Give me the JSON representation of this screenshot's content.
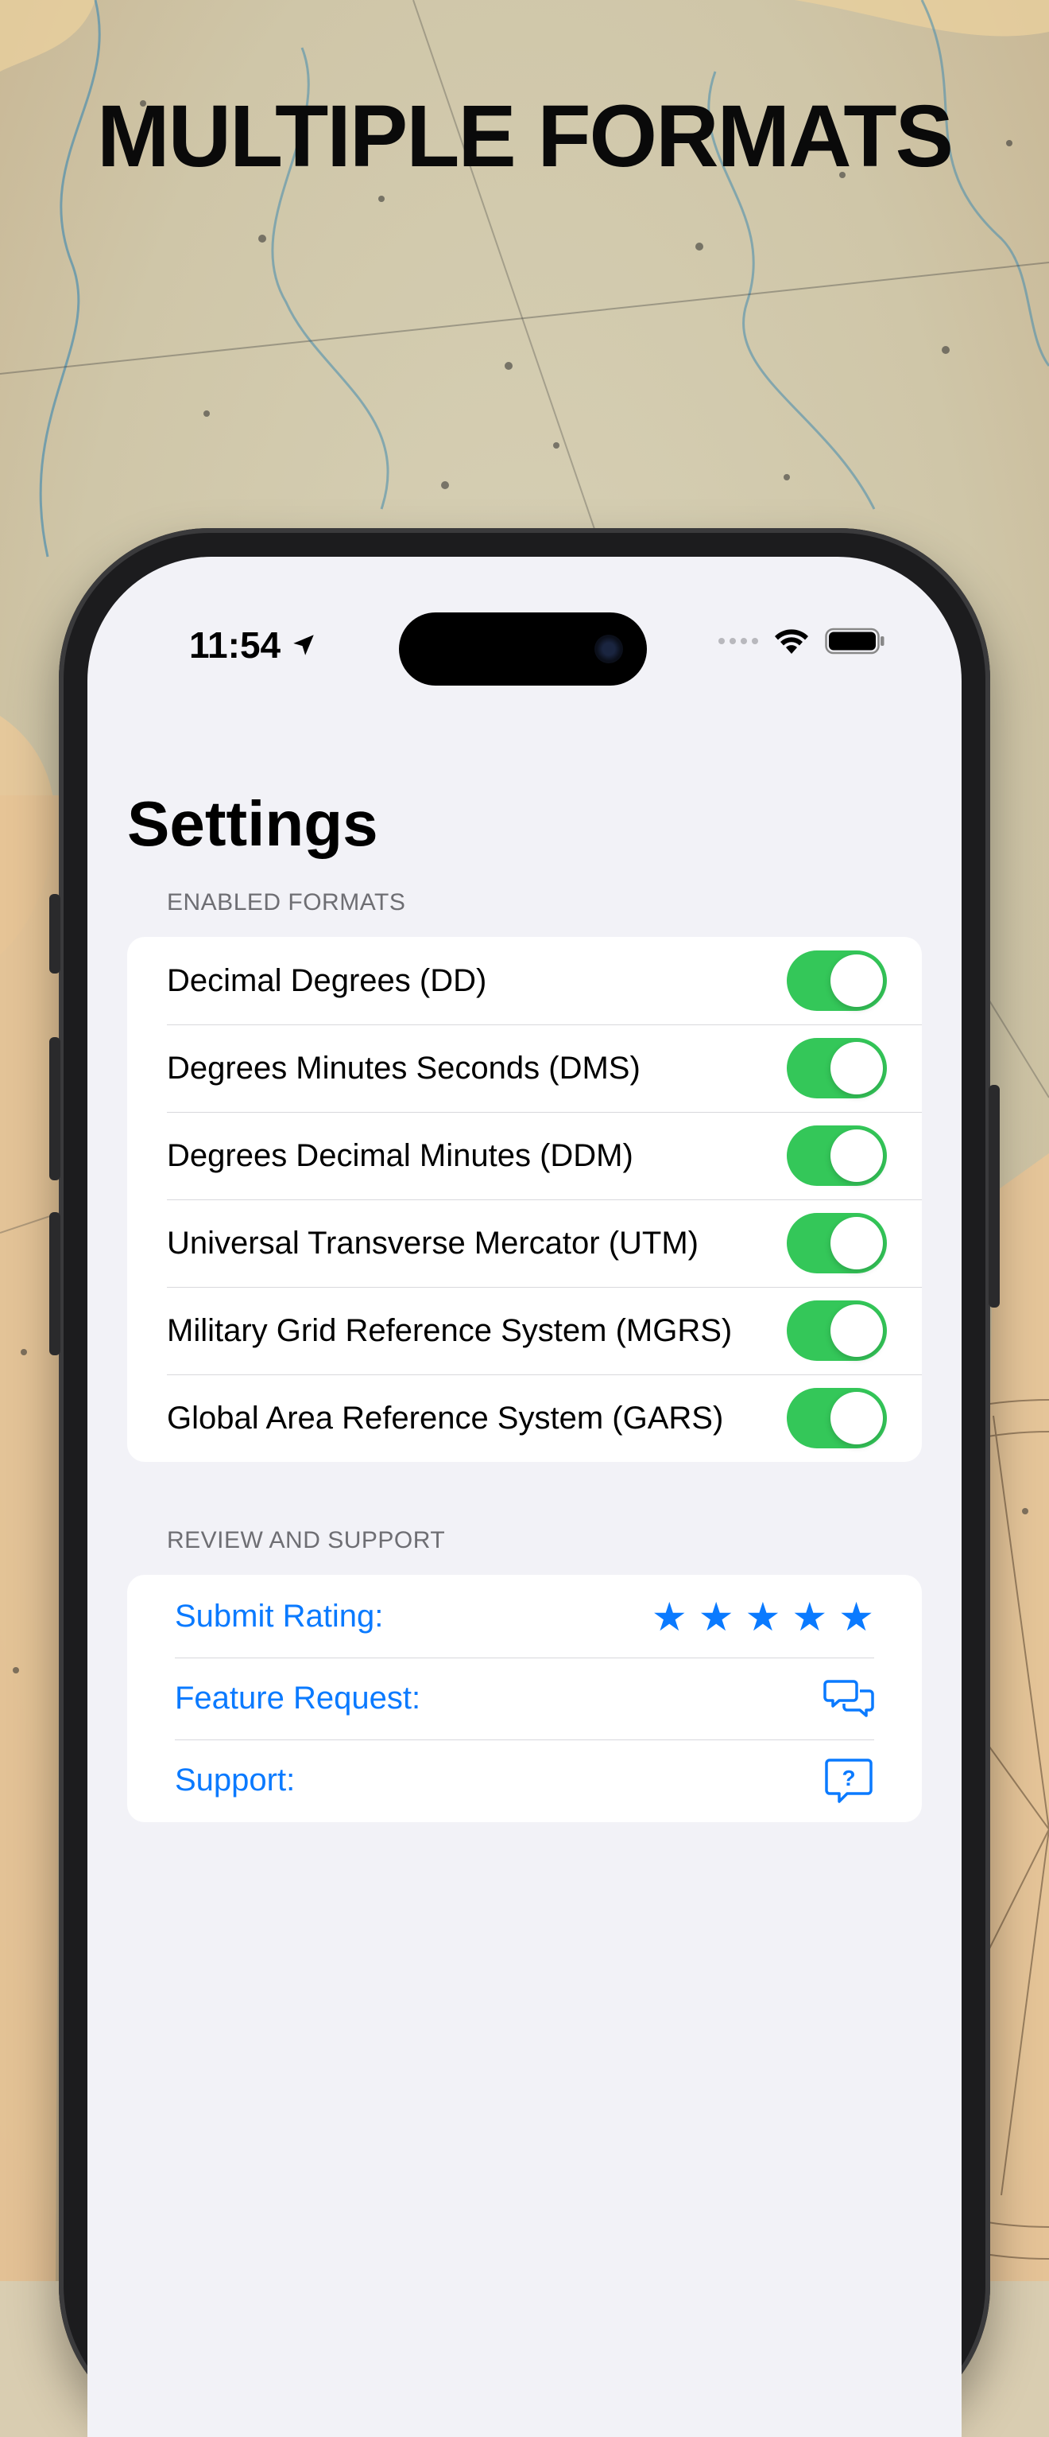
{
  "promo": {
    "title": "MULTIPLE FORMATS"
  },
  "status_bar": {
    "time": "11:54"
  },
  "nav": {
    "title": "Settings"
  },
  "sections": {
    "formats": {
      "header": "ENABLED FORMATS",
      "items": [
        {
          "label": "Decimal Degrees (DD)",
          "enabled": true
        },
        {
          "label": "Degrees Minutes Seconds (DMS)",
          "enabled": true
        },
        {
          "label": "Degrees Decimal Minutes (DDM)",
          "enabled": true
        },
        {
          "label": "Universal Transverse Mercator (UTM)",
          "enabled": true
        },
        {
          "label": "Military Grid Reference System (MGRS)",
          "enabled": true
        },
        {
          "label": "Global Area Reference System (GARS)",
          "enabled": true
        }
      ]
    },
    "support": {
      "header": "REVIEW AND SUPPORT",
      "items": [
        {
          "label": "Submit Rating:",
          "icon": "star-icon"
        },
        {
          "label": "Feature Request:",
          "icon": "chat-bubbles-icon"
        },
        {
          "label": "Support:",
          "icon": "question-bubble-icon"
        }
      ],
      "rating_stars": 5
    }
  },
  "colors": {
    "toggle_on": "#34c759",
    "accent": "#0a7aff",
    "grouped_background": "#f2f2f7"
  }
}
